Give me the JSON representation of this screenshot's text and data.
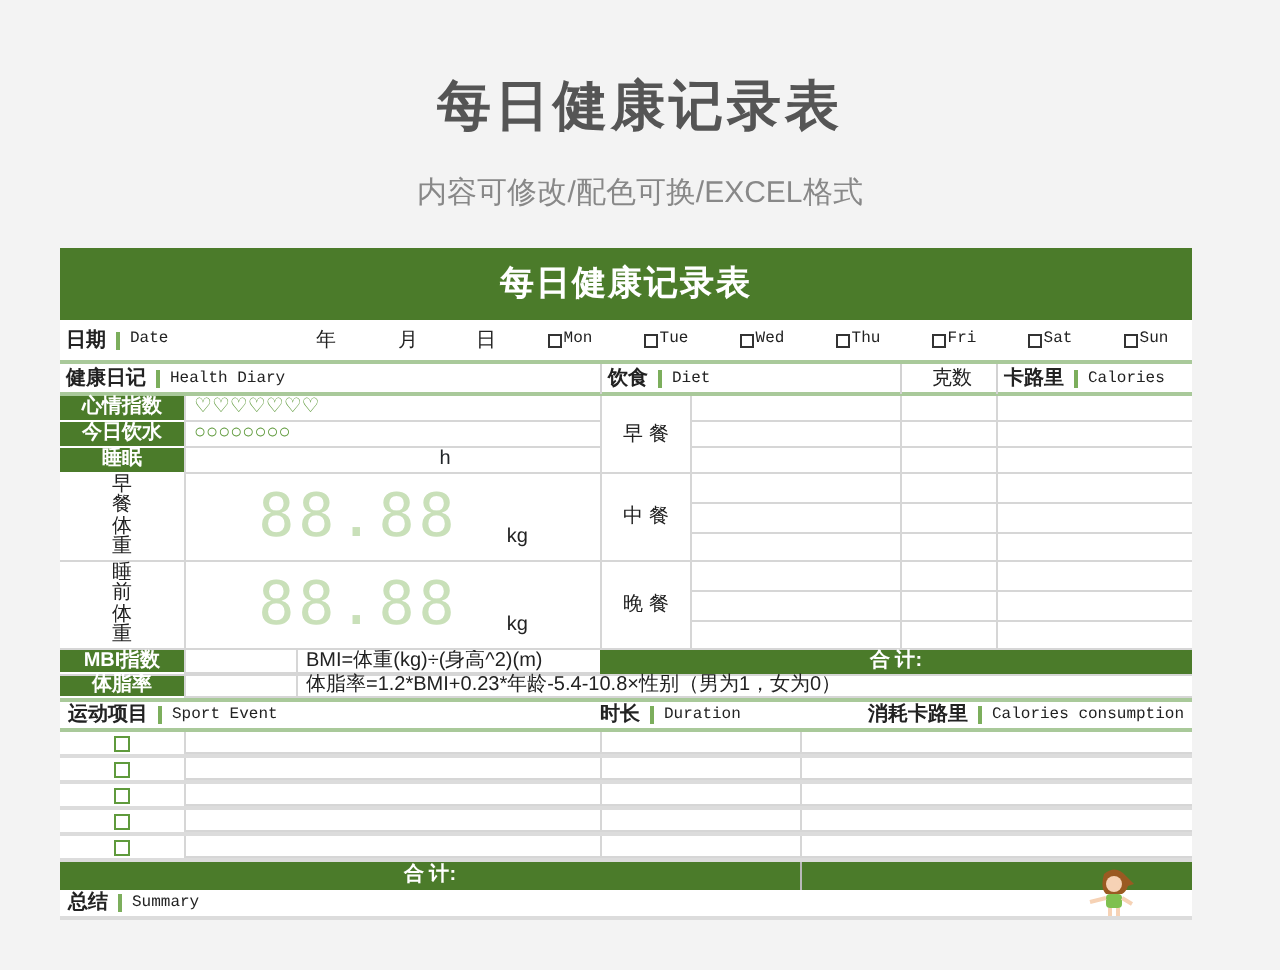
{
  "page_title": "每日健康记录表",
  "subtitle": "内容可修改/配色可换/EXCEL格式",
  "sheet": {
    "title": "每日健康记录表",
    "date_row": {
      "label": "日期",
      "label_en": "Date",
      "year": "年",
      "month": "月",
      "day": "日",
      "weekdays": [
        {
          "label": "Mon",
          "checked": false
        },
        {
          "label": "Tue",
          "checked": false
        },
        {
          "label": "Wed",
          "checked": false
        },
        {
          "label": "Thu",
          "checked": false
        },
        {
          "label": "Fri",
          "checked": false
        },
        {
          "label": "Sat",
          "checked": false
        },
        {
          "label": "Sun",
          "checked": false
        }
      ]
    },
    "diary": {
      "label": "健康日记",
      "label_en": "Health Diary",
      "mood": {
        "label": "心情指数",
        "value": "♡♡♡♡♡♡♡"
      },
      "water": {
        "label": "今日饮水",
        "value": "○○○○○○○○"
      },
      "sleep": {
        "label": "睡眠",
        "unit": "h"
      },
      "weights": [
        {
          "label": "早餐体重",
          "display": "88.88",
          "unit": "kg"
        },
        {
          "label": "睡前体重",
          "display": "88.88",
          "unit": "kg"
        }
      ]
    },
    "diet": {
      "label": "饮食",
      "label_en": "Diet",
      "grams": "克数",
      "calories": "卡路里",
      "calories_en": "Calories",
      "meals": [
        {
          "label": "早 餐"
        },
        {
          "label": "中 餐"
        },
        {
          "label": "晚 餐"
        }
      ],
      "total": "合 计:"
    },
    "bmi": {
      "label": "MBI指数",
      "formula": "BMI=体重(kg)÷(身高^2)(m)"
    },
    "body_fat": {
      "label": "体脂率",
      "formula": "体脂率=1.2*BMI+0.23*年龄-5.4-10.8×性别（男为1，女为0）"
    },
    "sport": {
      "label": "运动项目",
      "label_en": "Sport Event",
      "duration": "时长",
      "duration_en": "Duration",
      "calories": "消耗卡路里",
      "calories_en": "Calories consumption",
      "rows": [
        {
          "checked": false
        },
        {
          "checked": false
        },
        {
          "checked": false
        },
        {
          "checked": false
        },
        {
          "checked": false
        }
      ],
      "total": "合 计:"
    },
    "summary": {
      "label": "总结",
      "label_en": "Summary"
    }
  }
}
